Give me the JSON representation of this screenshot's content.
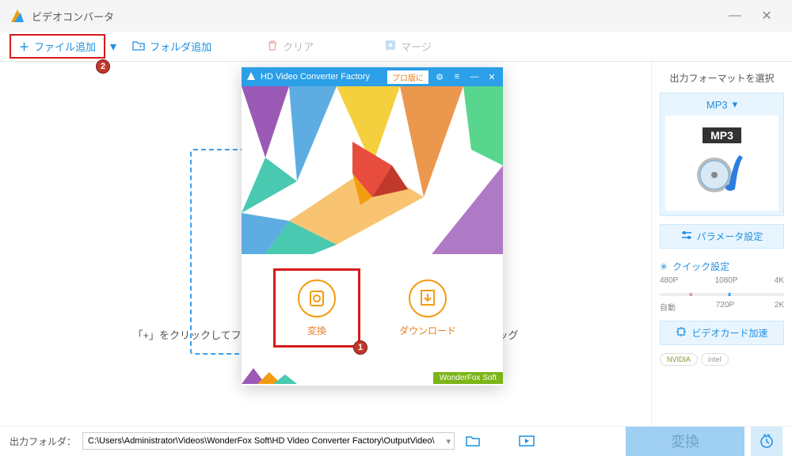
{
  "titlebar": {
    "title": "ビデオコンバータ"
  },
  "toolbar": {
    "addfile": "ファイル追加",
    "addfolder": "フォルダ追加",
    "clear": "クリア",
    "merge": "マージ"
  },
  "markers": {
    "one": "1",
    "two": "2"
  },
  "dropzone": {
    "hint": "「+」をクリックしてファイルを追加するか、複数のビデオやオーディオをドラッグします。"
  },
  "launcher": {
    "title": "HD Video Converter Factory",
    "pro": "プロ版に",
    "convert": "変換",
    "download": "ダウンロード",
    "brand": "WonderFox Soft"
  },
  "sidebar": {
    "formattitle": "出力フォーマットを選択",
    "format": "MP3",
    "formattag": "MP3",
    "param": "パラメータ設定",
    "quick": "クイック設定",
    "scale_top": [
      "480P",
      "1080P",
      "4K"
    ],
    "scale_bottom": [
      "自動",
      "720P",
      "2K"
    ],
    "gpu": "ビデオカード加速",
    "gpus": [
      "NVIDIA",
      "intel"
    ]
  },
  "bottombar": {
    "label": "出力フォルダ：",
    "path": "C:\\Users\\Administrator\\Videos\\WonderFox Soft\\HD Video Converter Factory\\OutputVideo\\",
    "convert": "変換"
  }
}
